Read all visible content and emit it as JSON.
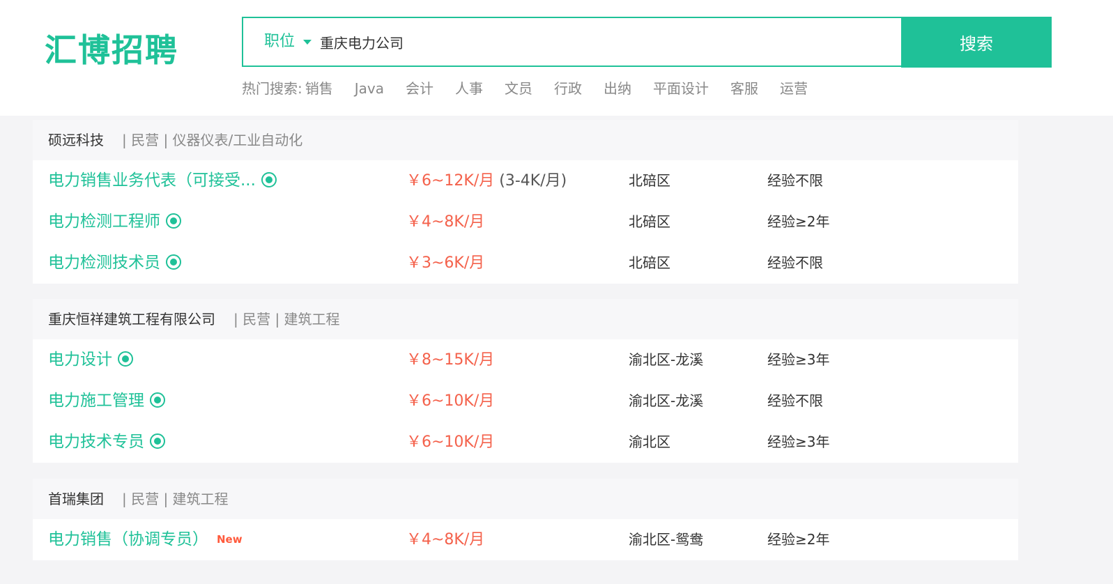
{
  "header": {
    "logo": "汇博招聘",
    "search": {
      "category": "职位",
      "query": "重庆电力公司",
      "button": "搜索"
    },
    "hot": {
      "label": "热门搜索:",
      "items": [
        "销售",
        "Java",
        "会计",
        "人事",
        "文员",
        "行政",
        "出纳",
        "平面设计",
        "客服",
        "运营"
      ]
    }
  },
  "companies": [
    {
      "name": "硕远科技",
      "meta": "| 民营 | 仪器仪表/工业自动化",
      "jobs": [
        {
          "title": "电力销售业务代表（可接受...",
          "salary": "￥6~12K/月",
          "salary_extra": " (3-4K/月)",
          "location": "北碚区",
          "experience": "经验不限"
        },
        {
          "title": "电力检测工程师",
          "salary": "￥4~8K/月",
          "location": "北碚区",
          "experience": "经验≥2年"
        },
        {
          "title": "电力检测技术员",
          "salary": "￥3~6K/月",
          "location": "北碚区",
          "experience": "经验不限"
        }
      ]
    },
    {
      "name": "重庆恒祥建筑工程有限公司",
      "meta": "| 民营 | 建筑工程",
      "jobs": [
        {
          "title": "电力设计",
          "salary": "￥8~15K/月",
          "location": "渝北区-龙溪",
          "experience": "经验≥3年"
        },
        {
          "title": "电力施工管理",
          "salary": "￥6~10K/月",
          "location": "渝北区-龙溪",
          "experience": "经验不限"
        },
        {
          "title": "电力技术专员",
          "salary": "￥6~10K/月",
          "location": "渝北区",
          "experience": "经验≥3年"
        }
      ]
    },
    {
      "name": "首瑞集团",
      "meta": "| 民营 | 建筑工程",
      "jobs": [
        {
          "title": "电力销售（协调专员）",
          "badge": "New",
          "salary": "￥4~8K/月",
          "location": "渝北区-鸳鸯",
          "experience": "经验≥2年"
        }
      ]
    }
  ],
  "colors": {
    "accent": "#1fc198",
    "salary": "#f4614b",
    "new_badge": "#ff5a3c",
    "page_bg": "#f4f4f6"
  },
  "icons": {
    "chat": "chat-bubble-icon",
    "dropdown": "caret-down-icon"
  }
}
